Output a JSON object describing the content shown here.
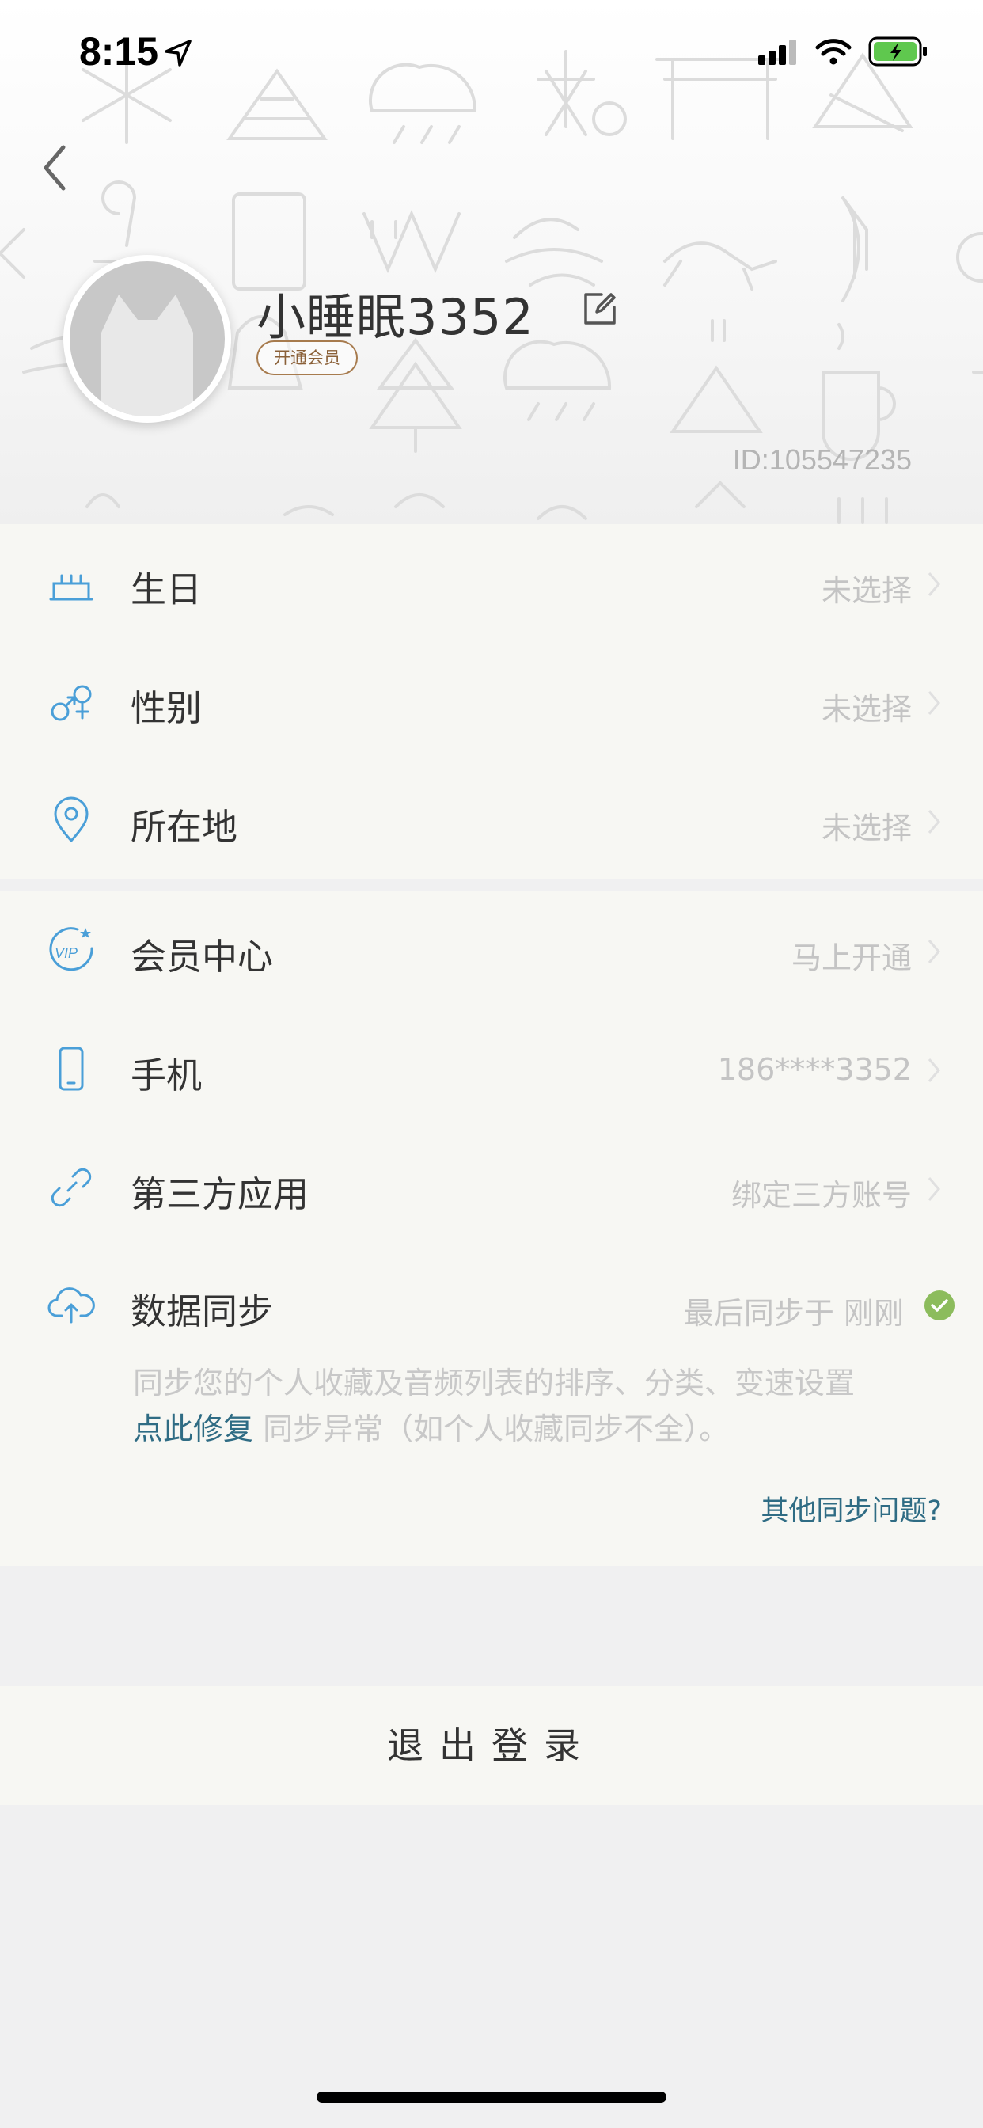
{
  "status_bar": {
    "time": "8:15"
  },
  "profile": {
    "username": "小睡眠3352",
    "vip_badge": "开通会员",
    "user_id": "ID:105547235"
  },
  "info_section": {
    "rows": [
      {
        "label": "生日",
        "value": "未选择",
        "icon": "cake-icon"
      },
      {
        "label": "性别",
        "value": "未选择",
        "icon": "gender-icon"
      },
      {
        "label": "所在地",
        "value": "未选择",
        "icon": "location-pin-icon"
      }
    ]
  },
  "account_section": {
    "rows": [
      {
        "label": "会员中心",
        "value": "马上开通",
        "icon": "vip-icon"
      },
      {
        "label": "手机",
        "value": "186****3352",
        "icon": "phone-icon"
      },
      {
        "label": "第三方应用",
        "value": "绑定三方账号",
        "icon": "link-icon"
      },
      {
        "label": "数据同步",
        "value": "最后同步于 刚刚",
        "icon": "cloud-sync-icon"
      }
    ],
    "sync_description": "同步您的个人收藏及音频列表的排序、分类、变速设置",
    "sync_fix_link": "点此修复",
    "sync_fix_text": " 同步异常（如个人收藏同步不全）。",
    "sync_other_link": "其他同步问题?"
  },
  "logout_label": "退出登录",
  "colors": {
    "accent_blue": "#4a9fd8",
    "link_teal": "#2f6c84",
    "badge_brown": "#a77b4e",
    "check_green": "#8cbc5c",
    "section_bg": "#f7f7f3",
    "page_bg": "#f0f0f1"
  }
}
